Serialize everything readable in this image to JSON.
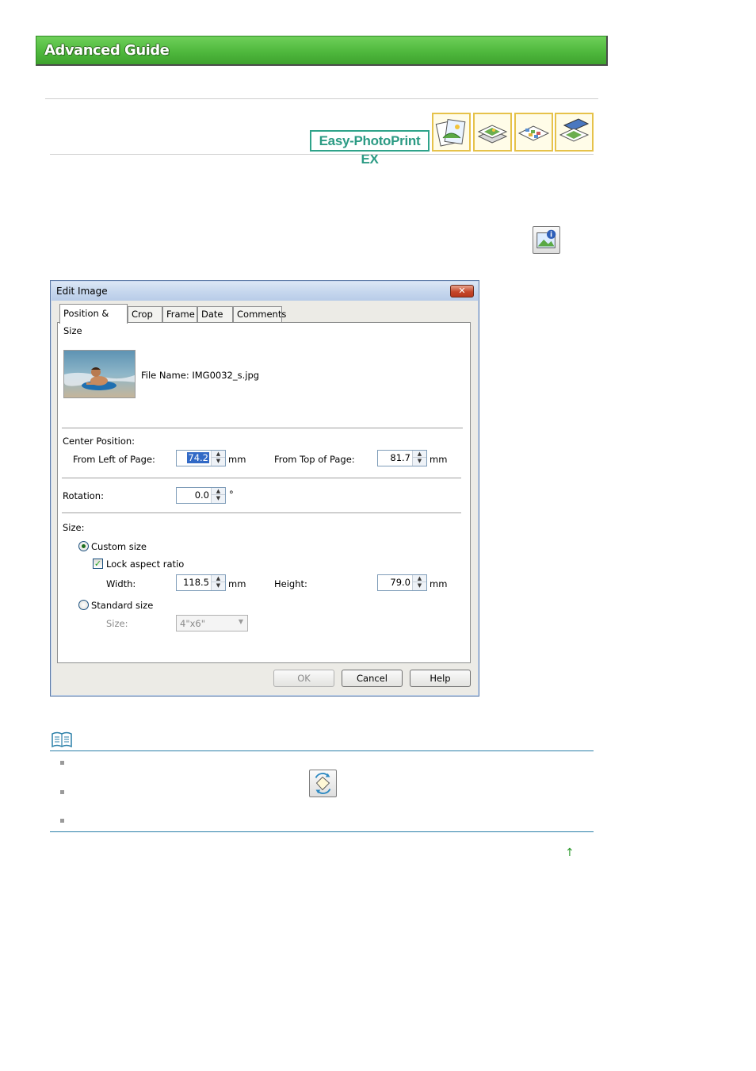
{
  "banner": {
    "title": "Advanced Guide"
  },
  "brand": {
    "label": "Easy-PhotoPrint EX"
  },
  "nav_icons": [
    "album-icon",
    "calendar-icon",
    "sticker-icon",
    "layout-print-icon"
  ],
  "dialog": {
    "title": "Edit Image",
    "close_label": "✕",
    "tabs": [
      "Position & Size",
      "Crop",
      "Frame",
      "Date",
      "Comments"
    ],
    "active_tab": "Position & Size",
    "file_name_label": "File Name:",
    "file_name": "IMG0032_s.jpg",
    "center_position": {
      "heading": "Center Position:",
      "from_left_label": "From Left of Page:",
      "from_left_value": "74.2",
      "from_top_label": "From Top of Page:",
      "from_top_value": "81.7",
      "unit": "mm"
    },
    "rotation": {
      "label": "Rotation:",
      "value": "0.0",
      "unit": "°"
    },
    "size": {
      "heading": "Size:",
      "custom_size_label": "Custom size",
      "lock_aspect_label": "Lock aspect ratio",
      "width_label": "Width:",
      "width_value": "118.5",
      "height_label": "Height:",
      "height_value": "79.0",
      "unit": "mm",
      "standard_size_label": "Standard size",
      "size_label": "Size:",
      "size_value": "4\"x6\""
    },
    "buttons": {
      "ok": "OK",
      "cancel": "Cancel",
      "help": "Help"
    }
  },
  "top_link": "↑"
}
